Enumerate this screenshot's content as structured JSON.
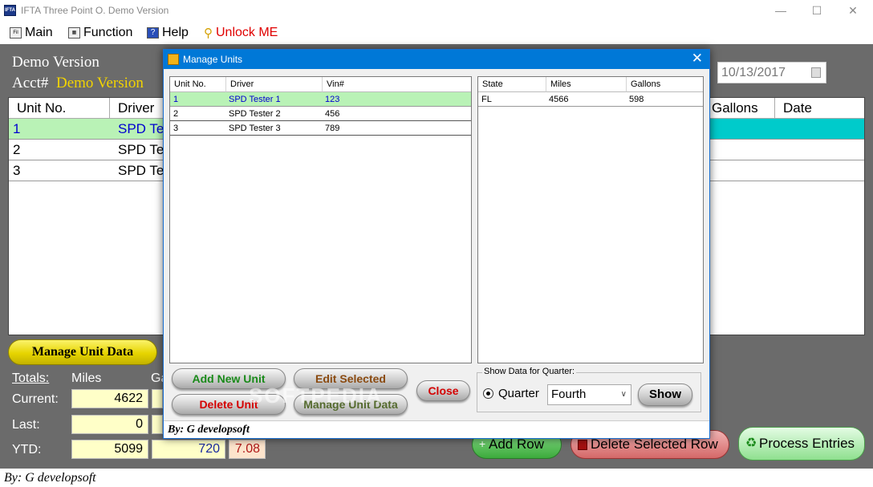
{
  "window": {
    "title": "IFTA Three Point O. Demo Version",
    "icon_text": "IFTA"
  },
  "menu": [
    {
      "label": "Main",
      "icon": "main-icon"
    },
    {
      "label": "Function",
      "icon": "function-icon"
    },
    {
      "label": "Help",
      "icon": "help-icon"
    },
    {
      "label": "Unlock ME",
      "icon": "key-icon",
      "color": "#e00000"
    }
  ],
  "header": {
    "version_label": "Demo Version",
    "acct_label": "Acct#",
    "acct_value": "Demo Version",
    "date": "10/13/2017"
  },
  "main_grid": {
    "columns": [
      "Unit No.",
      "Driver",
      "Gallons",
      "Date"
    ],
    "rows": [
      {
        "unit": "1",
        "driver": "SPD Te"
      },
      {
        "unit": "2",
        "driver": "SPD Te"
      },
      {
        "unit": "3",
        "driver": "SPD Te"
      }
    ]
  },
  "manage_unit_data_btn": "Manage Unit Data",
  "totals": {
    "label": "Totals:",
    "miles_label": "Miles",
    "gallons_label": "Ga",
    "current_label": "Current:",
    "last_label": "Last:",
    "ytd_label": "YTD:",
    "current_miles": "4622",
    "last_miles": "0",
    "ytd_miles": "5099",
    "ytd_gallons": "720",
    "ytd_mpg": "7.08"
  },
  "bottom_buttons": {
    "add_row": "Add Row",
    "delete_row": "Delete Selected Row",
    "process": "Process Entries"
  },
  "status": "By: G developsoft",
  "dialog": {
    "title": "Manage Units",
    "units": {
      "columns": [
        "Unit No.",
        "Driver",
        "Vin#"
      ],
      "rows": [
        {
          "unit": "1",
          "driver": "SPD Tester 1",
          "vin": "123"
        },
        {
          "unit": "2",
          "driver": "SPD Tester 2",
          "vin": "456"
        },
        {
          "unit": "3",
          "driver": "SPD Tester 3",
          "vin": "789"
        }
      ]
    },
    "states": {
      "columns": [
        "State",
        "Miles",
        "Gallons"
      ],
      "rows": [
        {
          "state": "FL",
          "miles": "4566",
          "gallons": "598"
        }
      ]
    },
    "buttons": {
      "add": "Add New Unit",
      "edit": "Edit Selected",
      "delete": "Delete Unit",
      "manage": "Manage Unit Data",
      "close": "Close",
      "show": "Show"
    },
    "quarter": {
      "group_label": "Show Data for Quarter:",
      "radio_label": "Quarter",
      "selected": "Fourth"
    },
    "footer": "By: G developsoft"
  },
  "watermark": "SOFTPEDIA",
  "colors": {
    "selected_row": "#b9f2b6",
    "accent_cyan": "#00cbcb",
    "titlebar_blue": "#0078d7"
  }
}
